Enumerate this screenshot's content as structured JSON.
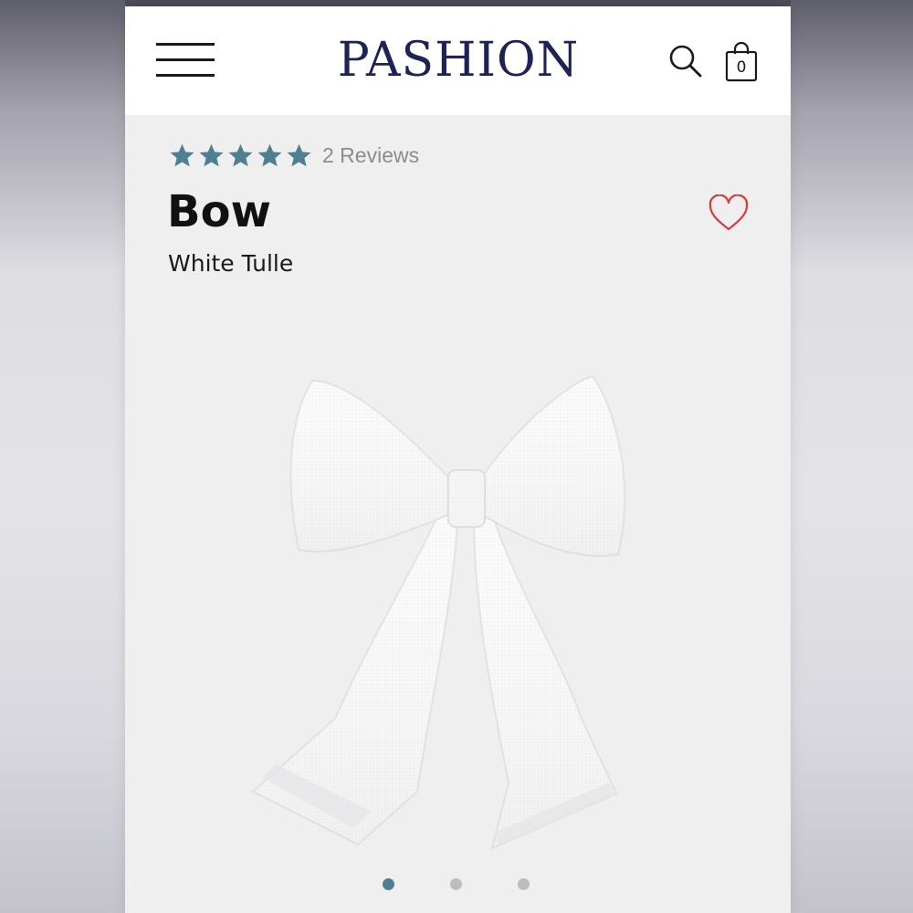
{
  "header": {
    "logo": "PASHION",
    "cart_count": "0",
    "icons": [
      "hamburger-menu-icon",
      "search-icon",
      "shopping-bag-icon"
    ]
  },
  "product": {
    "rating": 5,
    "rating_max": 5,
    "reviews_label": "2 Reviews",
    "name": "Bow",
    "variant": "White Tulle",
    "favorite_icon": "heart-outline-icon"
  },
  "gallery": {
    "count": 3,
    "active_index": 0
  },
  "colors": {
    "logo": "#1d2257",
    "star": "#4f7f92",
    "heart": "#d83a3a",
    "dot_active": "#4f7f92",
    "dot_inactive": "#bdbdbd"
  }
}
